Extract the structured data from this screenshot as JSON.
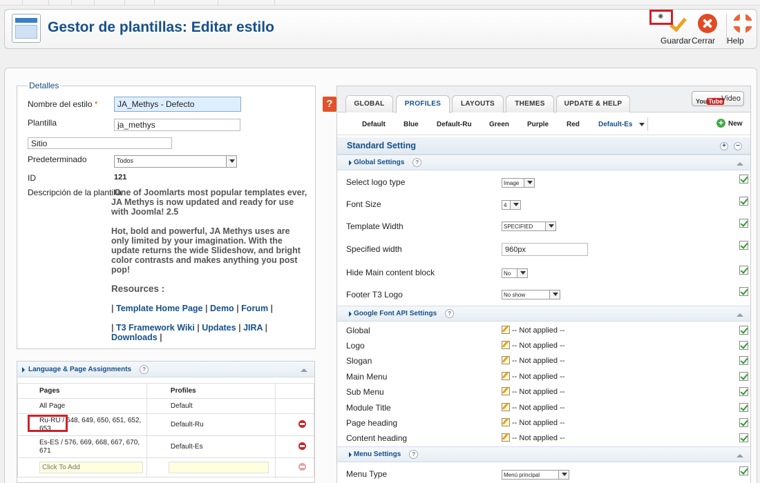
{
  "header": {
    "title": "Gestor de plantillas: Editar estilo",
    "save_label": "Guardar",
    "close_label": "Cerrar",
    "help_label": "Help"
  },
  "details": {
    "legend": "Detalles",
    "style_name_label": "Nombre del estilo",
    "required_mark": "*",
    "style_name_value": "JA_Methys - Defecto",
    "template_label": "Plantilla",
    "template_value": "ja_methys",
    "site_value": "Sitio",
    "default_label": "Predeterminado",
    "default_value": "Todos",
    "id_label": "ID",
    "id_value": "121",
    "description_label": "Descripción de la plantilla",
    "description": {
      "p1": "One of Joomlarts most popular templates ever, JA Methys is now updated and ready for use with Joomla! 2.5",
      "p2": "Hot, bold and powerful, JA Methys uses are only limited by your imagination. With the update returns the wide Slideshow, and bright color contrasts and makes anything you post pop!",
      "resources": "Resources :",
      "sep": "|",
      "links1": [
        "Template Home Page",
        "Demo",
        "Forum"
      ],
      "links2": [
        "T3 Framework Wiki",
        "Updates",
        "JIRA",
        "Downloads"
      ]
    }
  },
  "language_panel": {
    "title": "Language & Page Assignments",
    "help": "?",
    "col_pages": "Pages",
    "col_profiles": "Profiles",
    "rows": [
      {
        "pages": "All Page",
        "profile": "Default"
      },
      {
        "pages": "Ru-RU / 648, 649, 650, 651, 652, 653",
        "profile": "Default-Ru"
      },
      {
        "pages": "Es-ES / 576, 669, 668, 667, 670, 671",
        "profile": "Default-Es"
      }
    ],
    "add_placeholder": "Click To Add"
  },
  "help_badge": "?",
  "tabs": [
    "GLOBAL",
    "PROFILES",
    "LAYOUTS",
    "THEMES",
    "UPDATE & HELP"
  ],
  "active_tab": "PROFILES",
  "video_button": {
    "logo_you": "You",
    "logo_tube": "Tube",
    "label": "Video"
  },
  "profiles": [
    "Default",
    "Blue",
    "Default-Ru",
    "Green",
    "Purple",
    "Red",
    "Default-Es"
  ],
  "active_profile": "Default-Es",
  "new_label": "New",
  "standard_setting": {
    "title": "Standard Setting",
    "expand": "+",
    "collapse": "−"
  },
  "global_settings": {
    "title": "Global Settings",
    "help": "?",
    "items": [
      {
        "label": "Select logo type",
        "value": "Image"
      },
      {
        "label": "Font Size",
        "value": "4"
      },
      {
        "label": "Template Width",
        "value": "SPECIFIED"
      },
      {
        "label": "Specified width",
        "value": "960px"
      },
      {
        "label": "Hide Main content block",
        "value": "No"
      },
      {
        "label": "Footer T3 Logo",
        "value": "No show"
      }
    ]
  },
  "google_font": {
    "title": "Google Font API Settings",
    "help": "?",
    "items": [
      {
        "label": "Global",
        "value": "-- Not applied --"
      },
      {
        "label": "Logo",
        "value": "-- Not applied --"
      },
      {
        "label": "Slogan",
        "value": "-- Not applied --"
      },
      {
        "label": "Main Menu",
        "value": "-- Not applied --"
      },
      {
        "label": "Sub Menu",
        "value": "-- Not applied --"
      },
      {
        "label": "Module Title",
        "value": "-- Not applied --"
      },
      {
        "label": "Page heading",
        "value": "-- Not applied --"
      },
      {
        "label": "Content heading",
        "value": "-- Not applied --"
      }
    ]
  },
  "menu_settings": {
    "title": "Menu Settings",
    "help": "?",
    "items": [
      {
        "label": "Menu Type",
        "value": "Menú principal"
      }
    ]
  },
  "colors": {
    "accent": "#15508a",
    "highlight_box": "#d0202a",
    "check": "#2a9a2a"
  }
}
